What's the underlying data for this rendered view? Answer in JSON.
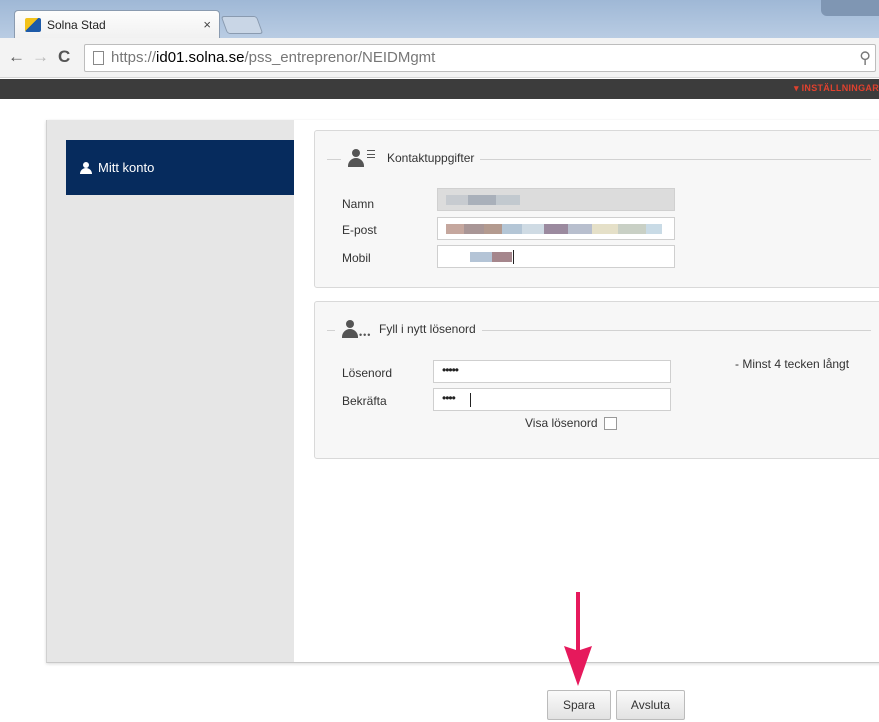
{
  "browser": {
    "tab_title": "Solna Stad",
    "tab_close": "×",
    "url_prefix": "https://",
    "url_host": "id01.solna.se",
    "url_path": "/pss_entreprenor/NEIDMgmt",
    "icons": [
      "back-icon",
      "forward-icon",
      "reload-icon",
      "page-icon",
      "zoom-icon"
    ]
  },
  "topbar": {
    "settings_label": "▾ INSTÄLLNINGAR"
  },
  "sidebar": {
    "items": [
      {
        "label": "Mitt konto",
        "icon": "user-icon",
        "selected": true
      }
    ]
  },
  "contact": {
    "title": "Kontaktuppgifter",
    "help": "?",
    "fields": [
      {
        "label": "Namn"
      },
      {
        "label": "E-post"
      },
      {
        "label": "Mobil"
      }
    ]
  },
  "password": {
    "title": "Fyll i nytt lösenord",
    "help": "?",
    "new_label": "Lösenord",
    "new_value": "•••••",
    "confirm_label": "Bekräfta",
    "confirm_value": "••••",
    "hint": "- Minst 4 tecken långt",
    "show_label": "Visa lösenord",
    "show_checked": false
  },
  "buttons": {
    "save_label": "Spara",
    "close_label": "Avsluta"
  },
  "colors": {
    "sidebar_active": "#062b5d",
    "settings_accent": "#e0412e",
    "annotation_arrow": "#e6195c"
  }
}
